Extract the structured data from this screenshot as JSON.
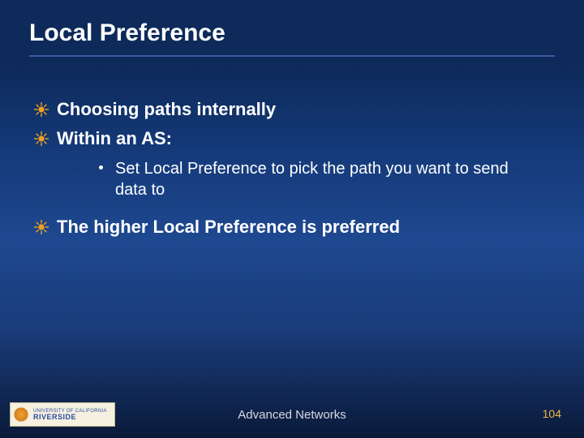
{
  "title": "Local Preference",
  "bullets": [
    {
      "text": "Choosing paths internally"
    },
    {
      "text": "Within an AS:",
      "sub": [
        {
          "text": "Set Local Preference to pick the path you want to send data to"
        }
      ]
    },
    {
      "text": "The higher Local Preference is preferred"
    }
  ],
  "logo": {
    "line1": "UNIVERSITY OF CALIFORNIA",
    "line2": "RIVERSIDE"
  },
  "footer": {
    "center": "Advanced Networks",
    "page": "104"
  }
}
